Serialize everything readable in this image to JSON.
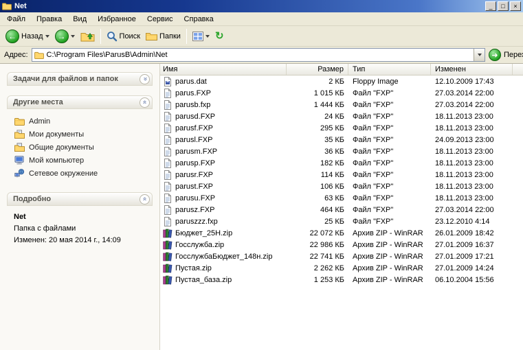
{
  "window": {
    "title": "Net"
  },
  "icons": {
    "minimize": "_",
    "maximize": "□",
    "close": "×",
    "back_arrow": "←",
    "forward_arrow": "→",
    "go_arrow": "➜",
    "refresh": "↻",
    "chevron": "»"
  },
  "menu": {
    "items": [
      {
        "label": "Файл",
        "key": "file"
      },
      {
        "label": "Правка",
        "key": "edit"
      },
      {
        "label": "Вид",
        "key": "view"
      },
      {
        "label": "Избранное",
        "key": "favorites"
      },
      {
        "label": "Сервис",
        "key": "tools"
      },
      {
        "label": "Справка",
        "key": "help"
      }
    ]
  },
  "toolbar": {
    "back": "Назад",
    "search": "Поиск",
    "folders": "Папки"
  },
  "address": {
    "label": "Адрес:",
    "value": "C:\\Program Files\\ParusB\\Admin\\Net",
    "go": "Переход"
  },
  "sidebar": {
    "tasks": {
      "title": "Задачи для файлов и папок"
    },
    "places": {
      "title": "Другие места",
      "items": [
        {
          "label": "Admin",
          "icon": "folder-icon"
        },
        {
          "label": "Мои документы",
          "icon": "my-documents-icon"
        },
        {
          "label": "Общие документы",
          "icon": "shared-documents-icon"
        },
        {
          "label": "Мой компьютер",
          "icon": "my-computer-icon"
        },
        {
          "label": "Сетевое окружение",
          "icon": "network-icon"
        }
      ]
    },
    "details": {
      "title": "Подробно",
      "name": "Net",
      "type": "Папка с файлами",
      "modified": "Изменен: 20 мая 2014 г., 14:09"
    }
  },
  "filelist": {
    "columns": [
      "Имя",
      "Размер",
      "Тип",
      "Изменен"
    ],
    "rows": [
      {
        "name": "parus.dat",
        "size": "2 КБ",
        "type": "Floppy Image",
        "modified": "12.10.2009 17:43",
        "icon": "floppy-image-icon"
      },
      {
        "name": "parus.FXP",
        "size": "1 015 КБ",
        "type": "Файл \"FXP\"",
        "modified": "27.03.2014 22:00",
        "icon": "fxp-document-icon"
      },
      {
        "name": "parusb.fxp",
        "size": "1 444 КБ",
        "type": "Файл \"FXP\"",
        "modified": "27.03.2014 22:00",
        "icon": "fxp-document-icon"
      },
      {
        "name": "parusd.FXP",
        "size": "24 КБ",
        "type": "Файл \"FXP\"",
        "modified": "18.11.2013 23:00",
        "icon": "fxp-document-icon"
      },
      {
        "name": "parusf.FXP",
        "size": "295 КБ",
        "type": "Файл \"FXP\"",
        "modified": "18.11.2013 23:00",
        "icon": "fxp-document-icon"
      },
      {
        "name": "parusl.FXP",
        "size": "35 КБ",
        "type": "Файл \"FXP\"",
        "modified": "24.09.2013 23:00",
        "icon": "fxp-document-icon"
      },
      {
        "name": "parusm.FXP",
        "size": "36 КБ",
        "type": "Файл \"FXP\"",
        "modified": "18.11.2013 23:00",
        "icon": "fxp-document-icon"
      },
      {
        "name": "parusp.FXP",
        "size": "182 КБ",
        "type": "Файл \"FXP\"",
        "modified": "18.11.2013 23:00",
        "icon": "fxp-document-icon"
      },
      {
        "name": "parusr.FXP",
        "size": "114 КБ",
        "type": "Файл \"FXP\"",
        "modified": "18.11.2013 23:00",
        "icon": "fxp-document-icon"
      },
      {
        "name": "parust.FXP",
        "size": "106 КБ",
        "type": "Файл \"FXP\"",
        "modified": "18.11.2013 23:00",
        "icon": "fxp-document-icon"
      },
      {
        "name": "parusu.FXP",
        "size": "63 КБ",
        "type": "Файл \"FXP\"",
        "modified": "18.11.2013 23:00",
        "icon": "fxp-document-icon"
      },
      {
        "name": "parusz.FXP",
        "size": "464 КБ",
        "type": "Файл \"FXP\"",
        "modified": "27.03.2014 22:00",
        "icon": "fxp-document-icon"
      },
      {
        "name": "paruszzz.fxp",
        "size": "25 КБ",
        "type": "Файл \"FXP\"",
        "modified": "23.12.2010 4:14",
        "icon": "fxp-document-icon"
      },
      {
        "name": "Бюджет_25Н.zip",
        "size": "22 072 КБ",
        "type": "Архив ZIP - WinRAR",
        "modified": "26.01.2009 18:42",
        "icon": "winrar-archive-icon"
      },
      {
        "name": "Госслужба.zip",
        "size": "22 986 КБ",
        "type": "Архив ZIP - WinRAR",
        "modified": "27.01.2009 16:37",
        "icon": "winrar-archive-icon"
      },
      {
        "name": "ГосслужбаБюджет_148н.zip",
        "size": "22 741 КБ",
        "type": "Архив ZIP - WinRAR",
        "modified": "27.01.2009 17:21",
        "icon": "winrar-archive-icon"
      },
      {
        "name": "Пустая.zip",
        "size": "2 262 КБ",
        "type": "Архив ZIP - WinRAR",
        "modified": "27.01.2009 14:24",
        "icon": "winrar-archive-icon"
      },
      {
        "name": "Пустая_база.zip",
        "size": "1 253 КБ",
        "type": "Архив ZIP - WinRAR",
        "modified": "06.10.2004 15:56",
        "icon": "winrar-archive-icon"
      }
    ]
  }
}
